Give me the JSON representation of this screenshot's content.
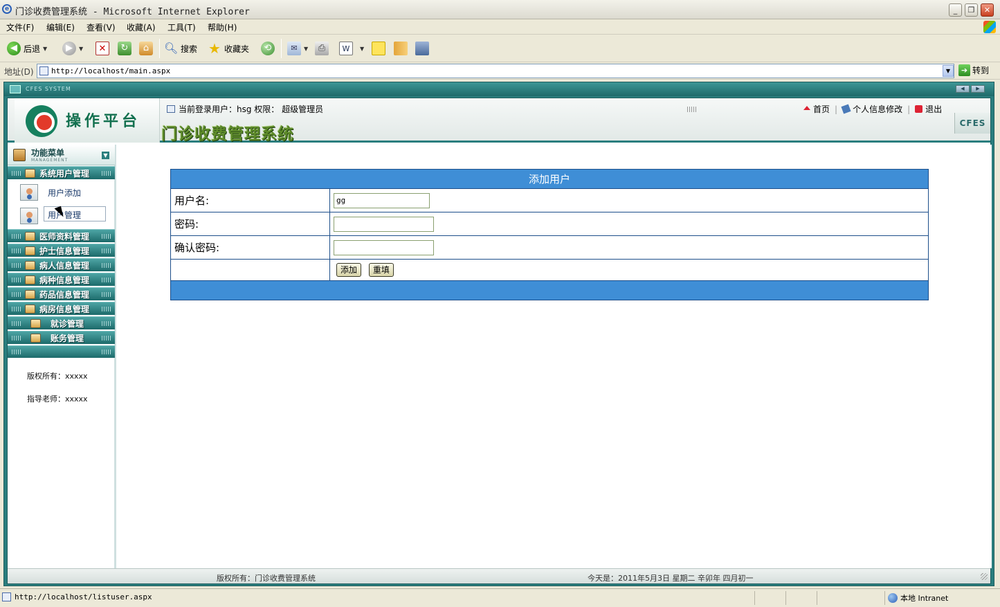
{
  "window": {
    "title": "门诊收费管理系统 - Microsoft Internet Explorer",
    "minimize": "_",
    "restore": "❐",
    "close": "✕"
  },
  "menu": {
    "items": [
      "文件(F)",
      "编辑(E)",
      "查看(V)",
      "收藏(A)",
      "工具(T)",
      "帮助(H)"
    ]
  },
  "toolbar": {
    "back_label": "后退",
    "search_label": "搜索",
    "favorites_label": "收藏夹"
  },
  "address": {
    "label": "地址(D)",
    "url": "http://localhost/main.aspx",
    "go_label": "转到"
  },
  "app": {
    "system_strip": "CFES SYSTEM",
    "brand": "操作平台",
    "system_name": "门诊收费管理系统",
    "current_user_text": "当前登录用户：hsg 权限：  超级管理员",
    "header_links": [
      "首页",
      "个人信息修改",
      "退出"
    ],
    "badge": "CFES",
    "sidebar": {
      "title": "功能菜单",
      "subtitle": "MANAGEMENT",
      "categories": [
        {
          "label": "系统用户管理"
        },
        {
          "label": "医师资料管理"
        },
        {
          "label": "护士信息管理"
        },
        {
          "label": "病人信息管理"
        },
        {
          "label": "病种信息管理"
        },
        {
          "label": "药品信息管理"
        },
        {
          "label": "病房信息管理"
        },
        {
          "label": "就诊管理"
        },
        {
          "label": "账务管理"
        }
      ],
      "sub_items": [
        {
          "label": "用户添加"
        },
        {
          "label": "用户管理"
        }
      ],
      "copyright": "版权所有：xxxxx",
      "advisor": "指导老师：xxxxx"
    },
    "form": {
      "title": "添加用户",
      "username_label": "用户名:",
      "username_value": "gg",
      "password_label": "密码:",
      "password_value": "",
      "confirm_label": "确认密码:",
      "confirm_value": "",
      "add_button": "添加",
      "reset_button": "重填"
    },
    "footer": {
      "copyright": "版权所有：门诊收费管理系统",
      "date": "今天是：2011年5月3日 星期二 辛卯年 四月初一"
    }
  },
  "status": {
    "url": "http://localhost/listuser.aspx",
    "zone": "本地 Intranet"
  }
}
